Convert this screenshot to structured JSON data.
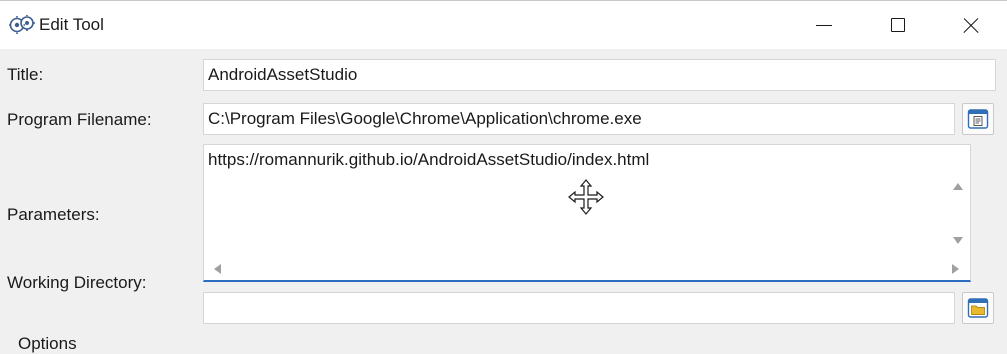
{
  "window": {
    "title": "Edit Tool",
    "icon": "app-gear-icon"
  },
  "controls": {
    "minimize_icon": "minimize-icon",
    "maximize_icon": "maximize-icon",
    "close_icon": "close-icon"
  },
  "form": {
    "title_label": "Title:",
    "title_value": "AndroidAssetStudio",
    "program_label": "Program Filename:",
    "program_value": "C:\\Program Files\\Google\\Chrome\\Application\\chrome.exe",
    "program_browse_icon": "file-browse-icon",
    "parameters_label": "Parameters:",
    "parameters_value": "https://romannurik.github.io/AndroidAssetStudio/index.html",
    "working_dir_label": "Working Directory:",
    "working_dir_value": "",
    "working_dir_browse_icon": "folder-browse-icon",
    "options_label": "Options"
  },
  "colors": {
    "focus_underline": "#2a6cc0",
    "folder_icon": "#e8b82e",
    "file_icon": "#2f6fb5"
  }
}
